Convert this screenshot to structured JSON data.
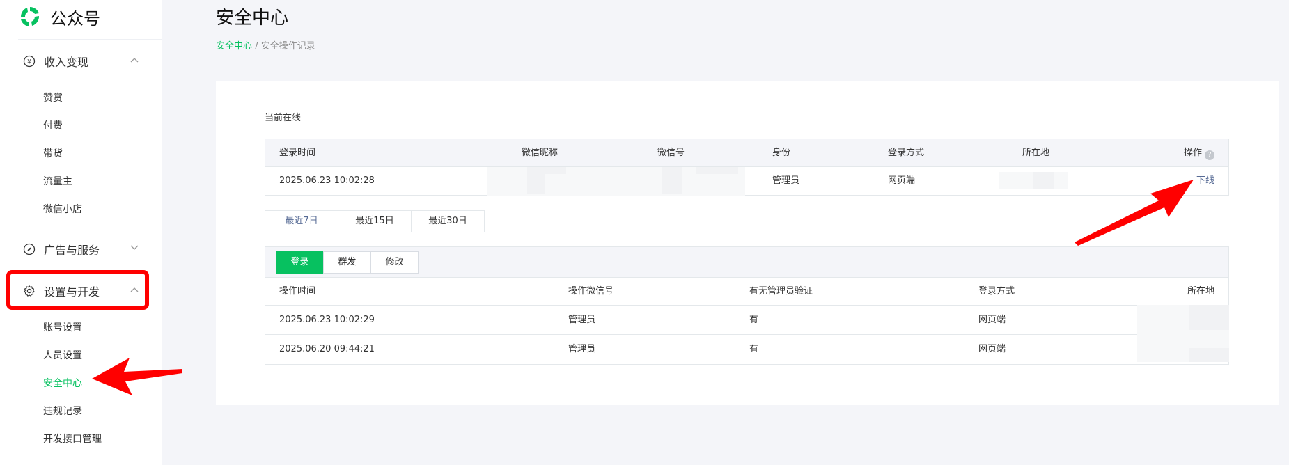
{
  "app": {
    "name": "公众号",
    "brand_color": "#07c160"
  },
  "sidebar": {
    "groups": [
      {
        "label": "收入变现",
        "icon": "yuan-icon",
        "items": [
          "赞赏",
          "付费",
          "带货",
          "流量主",
          "微信小店"
        ]
      },
      {
        "label": "广告与服务",
        "icon": "compass-icon",
        "items": []
      },
      {
        "label": "设置与开发",
        "icon": "gear-icon",
        "items": [
          "账号设置",
          "人员设置",
          "安全中心",
          "违规记录",
          "开发接口管理"
        ]
      }
    ],
    "active_item": "安全中心"
  },
  "page": {
    "title": "安全中心",
    "breadcrumb": {
      "link": "安全中心",
      "separator": "/",
      "current": "安全操作记录"
    }
  },
  "online": {
    "label": "当前在线",
    "columns": [
      "登录时间",
      "微信昵称",
      "微信号",
      "身份",
      "登录方式",
      "所在地",
      "操作"
    ],
    "row": {
      "time": "2025.06.23 10:02:28",
      "nickname": "",
      "wechat_id": "",
      "role": "管理员",
      "method": "网页端",
      "location": "",
      "action": "下线"
    }
  },
  "range_tabs": {
    "items": [
      "最近7日",
      "最近15日",
      "最近30日"
    ],
    "active": "最近7日"
  },
  "log": {
    "tabs": [
      "登录",
      "群发",
      "修改"
    ],
    "active_tab": "登录",
    "columns": [
      "操作时间",
      "操作微信号",
      "有无管理员验证",
      "登录方式",
      "所在地"
    ],
    "rows": [
      {
        "time": "2025.06.23 10:02:29",
        "operator": "管理员",
        "verified": "有",
        "method": "网页端",
        "location": ""
      },
      {
        "time": "2025.06.20 09:44:21",
        "operator": "管理员",
        "verified": "有",
        "method": "网页端",
        "location": ""
      }
    ]
  },
  "colors": {
    "accent": "#07c160",
    "link": "#576b95",
    "annotation": "#ff0000"
  }
}
